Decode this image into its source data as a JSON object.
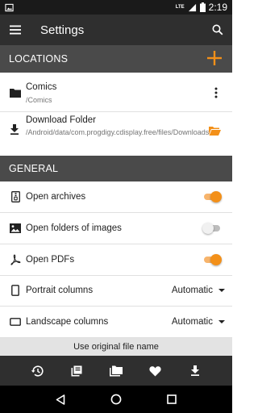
{
  "status_bar": {
    "network_label": "LTE",
    "time": "2:19"
  },
  "app_bar": {
    "title": "Settings",
    "menu_icon": "menu-icon",
    "search_icon": "search-icon"
  },
  "locations": {
    "header": "LOCATIONS",
    "items": [
      {
        "name": "Comics",
        "path": "/Comics",
        "icon": "folder-icon",
        "action_icon": "more-vert-icon"
      },
      {
        "name": "Download Folder",
        "path": "/Android/data/com.progdigy.cdisplay.free/files/Downloads",
        "icon": "download-icon",
        "action_icon": "folder-open-icon"
      }
    ]
  },
  "general": {
    "header": "GENERAL",
    "settings": [
      {
        "label": "Open archives",
        "icon": "archive-icon",
        "type": "toggle",
        "enabled": true
      },
      {
        "label": "Open folders of images",
        "icon": "image-icon",
        "type": "toggle",
        "enabled": false
      },
      {
        "label": "Open PDFs",
        "icon": "pdf-icon",
        "type": "toggle",
        "enabled": true
      },
      {
        "label": "Portrait columns",
        "icon": "portrait-icon",
        "type": "dropdown",
        "value": "Automatic"
      },
      {
        "label": "Landscape columns",
        "icon": "landscape-icon",
        "type": "dropdown",
        "value": "Automatic"
      }
    ],
    "partial_item": "Use original file name"
  },
  "bottom_nav": [
    "history-icon",
    "library-icon",
    "folders-icon",
    "favorites-icon",
    "downloads-icon"
  ],
  "system_nav": [
    "back-icon",
    "home-icon",
    "recents-icon"
  ],
  "colors": {
    "accent": "#f39019",
    "app_bar": "#2f2f2f",
    "section_header": "#4a4a4a",
    "status_bar": "#1a1a1a"
  }
}
